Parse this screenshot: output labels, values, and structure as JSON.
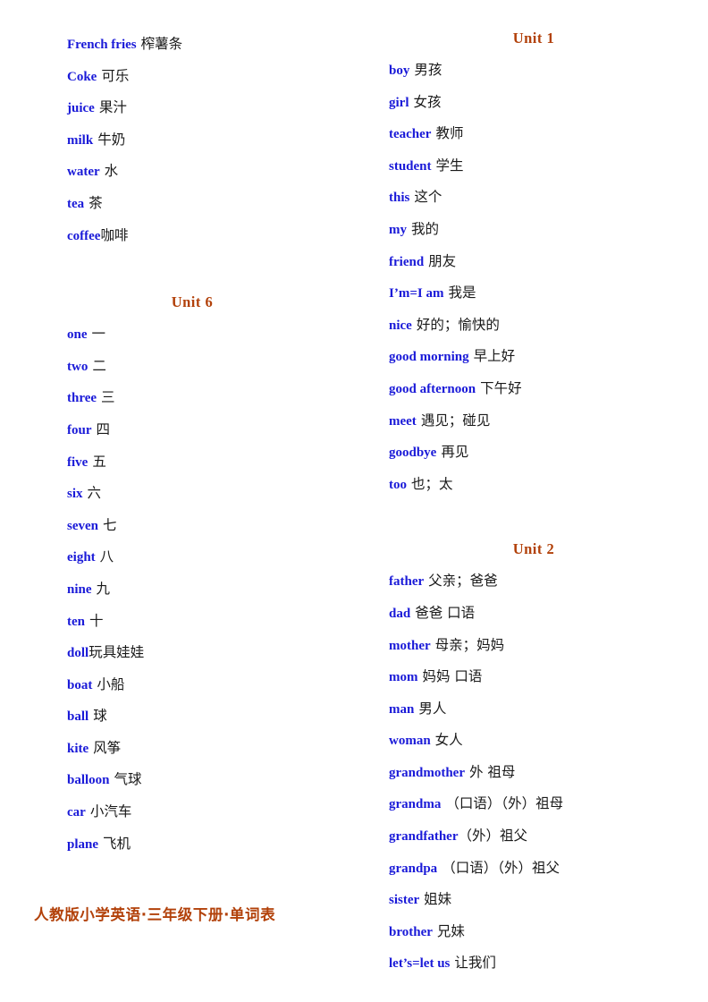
{
  "document": {
    "title": "人教版小学英语·三年级下册·单词表",
    "footer_label": "人教版小学英语·三年级下册·单词表",
    "colors": {
      "english_word": "#1A1AD8",
      "chinese_gloss": "#1a1a1a",
      "unit_heading": "#B2410A",
      "footer": "#B2410A",
      "background": "#ffffff"
    }
  },
  "left_column": {
    "continued_entries": [
      {
        "en": "French  fries",
        "zh": "榨薯条"
      },
      {
        "en": "Coke",
        "zh": "可乐"
      },
      {
        "en": "juice",
        "zh": "果汁"
      },
      {
        "en": "milk",
        "zh": "牛奶"
      },
      {
        "en": "water",
        "zh": "水"
      },
      {
        "en": "tea",
        "zh": "茶"
      },
      {
        "en": "coffee",
        "zh": "咖啡"
      }
    ],
    "unit": {
      "heading": "Unit  6",
      "entries": [
        {
          "en": "one",
          "zh": "一"
        },
        {
          "en": "two",
          "zh": "二"
        },
        {
          "en": "three",
          "zh": "三"
        },
        {
          "en": "four",
          "zh": "四"
        },
        {
          "en": "five",
          "zh": "五"
        },
        {
          "en": "six",
          "zh": "六"
        },
        {
          "en": "seven",
          "zh": "七"
        },
        {
          "en": "eight",
          "zh": "八"
        },
        {
          "en": "nine",
          "zh": "九"
        },
        {
          "en": "ten",
          "zh": "十"
        },
        {
          "en": "doll",
          "zh": "玩具娃娃"
        },
        {
          "en": "boat",
          "zh": "小船"
        },
        {
          "en": "ball",
          "zh": "球"
        },
        {
          "en": "kite",
          "zh": "风筝"
        },
        {
          "en": "balloon",
          "zh": "气球"
        },
        {
          "en": "car",
          "zh": "小汽车"
        },
        {
          "en": "plane",
          "zh": "飞机"
        }
      ]
    }
  },
  "right_column": {
    "unit_1": {
      "heading": "Unit  1",
      "entries": [
        {
          "en": "boy",
          "zh": "男孩"
        },
        {
          "en": "girl",
          "zh": "女孩"
        },
        {
          "en": "teacher",
          "zh": "教师"
        },
        {
          "en": "student",
          "zh": "学生"
        },
        {
          "en": "this",
          "zh": "这个"
        },
        {
          "en": "my",
          "zh": "我的"
        },
        {
          "en": "friend",
          "zh": "朋友"
        },
        {
          "en": "I’m=I  am",
          "zh": "我是"
        },
        {
          "en": "nice",
          "zh": "好的；愉快的"
        },
        {
          "en": "good  morning",
          "zh": "早上好"
        },
        {
          "en": "good  afternoon",
          "zh": "下午好"
        },
        {
          "en": "meet",
          "zh": "遇见；碰见"
        },
        {
          "en": "goodbye",
          "zh": "再见"
        },
        {
          "en": "too",
          "zh": "也；太"
        }
      ]
    },
    "unit_2": {
      "heading": "Unit  2",
      "entries": [
        {
          "en": "father",
          "zh": "父亲；爸爸"
        },
        {
          "en": "dad",
          "zh": "爸爸  口语"
        },
        {
          "en": "mother",
          "zh": "母亲；妈妈"
        },
        {
          "en": "mom",
          "zh": "妈妈  口语"
        },
        {
          "en": "man",
          "zh": "男人"
        },
        {
          "en": "woman",
          "zh": "女人"
        },
        {
          "en": "grandmother",
          "zh": "外  祖母"
        },
        {
          "en": "grandma",
          "zh": "（口语）（外）祖母"
        },
        {
          "en": "grandfather",
          "zh": "（外）祖父"
        },
        {
          "en": "grandpa",
          "zh": "（口语）（外）祖父"
        },
        {
          "en": "sister",
          "zh": "姐妹"
        },
        {
          "en": "brother",
          "zh": "兄妹"
        },
        {
          "en": "let’s=let  us",
          "zh": "让我们"
        }
      ]
    }
  }
}
